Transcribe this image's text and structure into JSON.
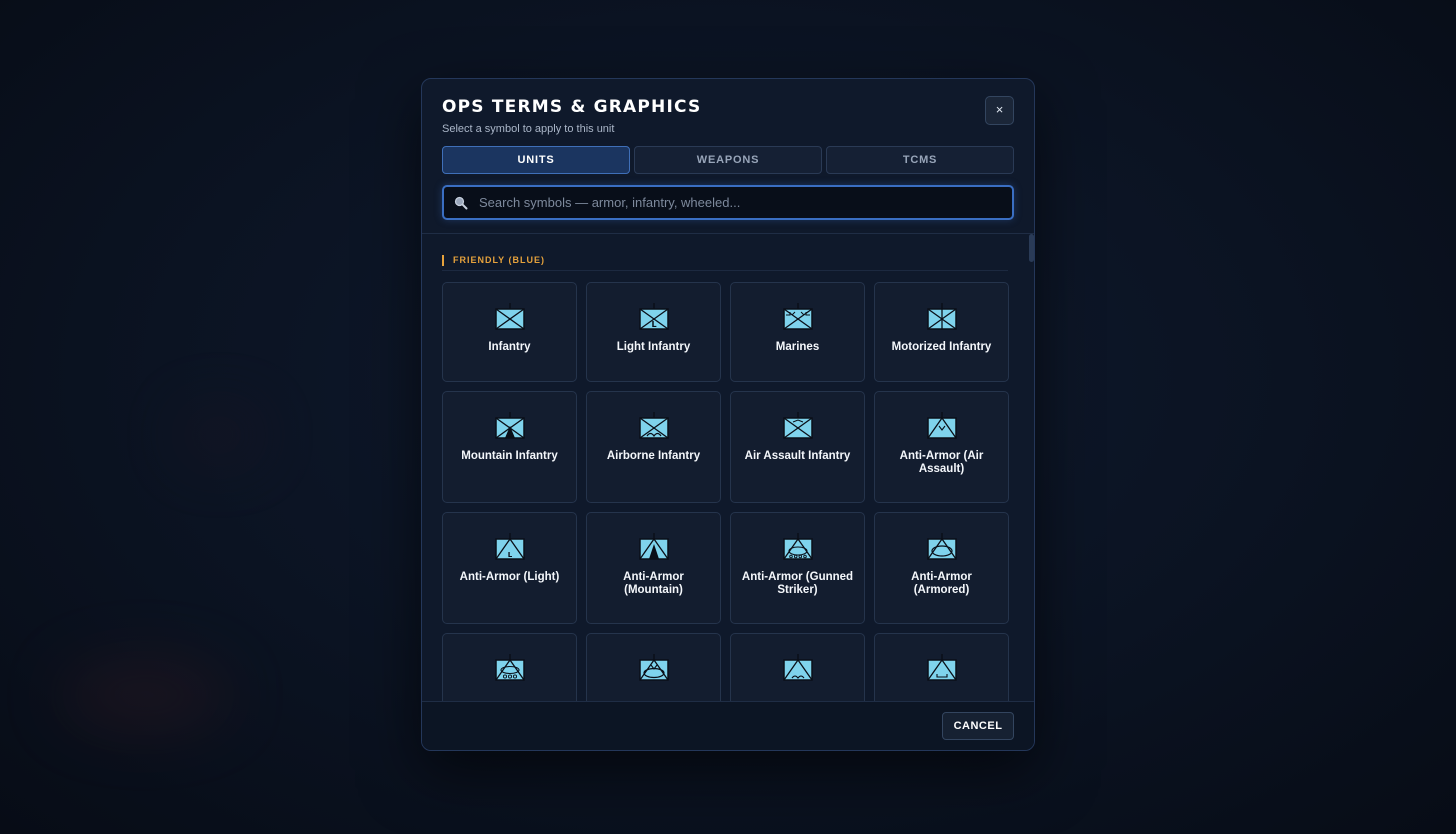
{
  "modal": {
    "title": "OPS TERMS & GRAPHICS",
    "subtitle": "Select a symbol to apply to this unit",
    "close_label": "×"
  },
  "tabs": [
    {
      "label": "UNITS",
      "active": true
    },
    {
      "label": "WEAPONS",
      "active": false
    },
    {
      "label": "TCMS",
      "active": false
    }
  ],
  "search": {
    "placeholder": "Search symbols — armor, infantry, wheeled...",
    "value": ""
  },
  "section": {
    "label": "FRIENDLY (BLUE)"
  },
  "symbols": [
    {
      "label": "Infantry",
      "icon": "infantry-symbol-icon"
    },
    {
      "label": "Light Infantry",
      "icon": "light-infantry-symbol-icon"
    },
    {
      "label": "Marines",
      "icon": "marines-symbol-icon"
    },
    {
      "label": "Motorized Infantry",
      "icon": "motorized-infantry-symbol-icon"
    },
    {
      "label": "Mountain Infantry",
      "icon": "mountain-infantry-symbol-icon"
    },
    {
      "label": "Airborne Infantry",
      "icon": "airborne-infantry-symbol-icon"
    },
    {
      "label": "Air Assault Infantry",
      "icon": "air-assault-infantry-symbol-icon"
    },
    {
      "label": "Anti-Armor (Air Assault)",
      "icon": "anti-armor-air-assault-symbol-icon"
    },
    {
      "label": "Anti-Armor (Light)",
      "icon": "anti-armor-light-symbol-icon"
    },
    {
      "label": "Anti-Armor (Mountain)",
      "icon": "anti-armor-mountain-symbol-icon"
    },
    {
      "label": "Anti-Armor (Gunned Striker)",
      "icon": "anti-armor-gunned-striker-symbol-icon"
    },
    {
      "label": "Anti-Armor (Armored)",
      "icon": "anti-armor-armored-symbol-icon"
    },
    {
      "label": "",
      "icon": "anti-armor-wheeled-symbol-icon"
    },
    {
      "label": "",
      "icon": "anti-armor-motorized-symbol-icon"
    },
    {
      "label": "",
      "icon": "anti-armor-airborne-symbol-icon"
    },
    {
      "label": "",
      "icon": "anti-armor-variant-symbol-icon"
    }
  ],
  "footer": {
    "cancel_label": "CANCEL"
  },
  "colors": {
    "symbol_fill": "#7fd3ec",
    "accent": "#3a6ec2",
    "section_label": "#e6a23c"
  }
}
